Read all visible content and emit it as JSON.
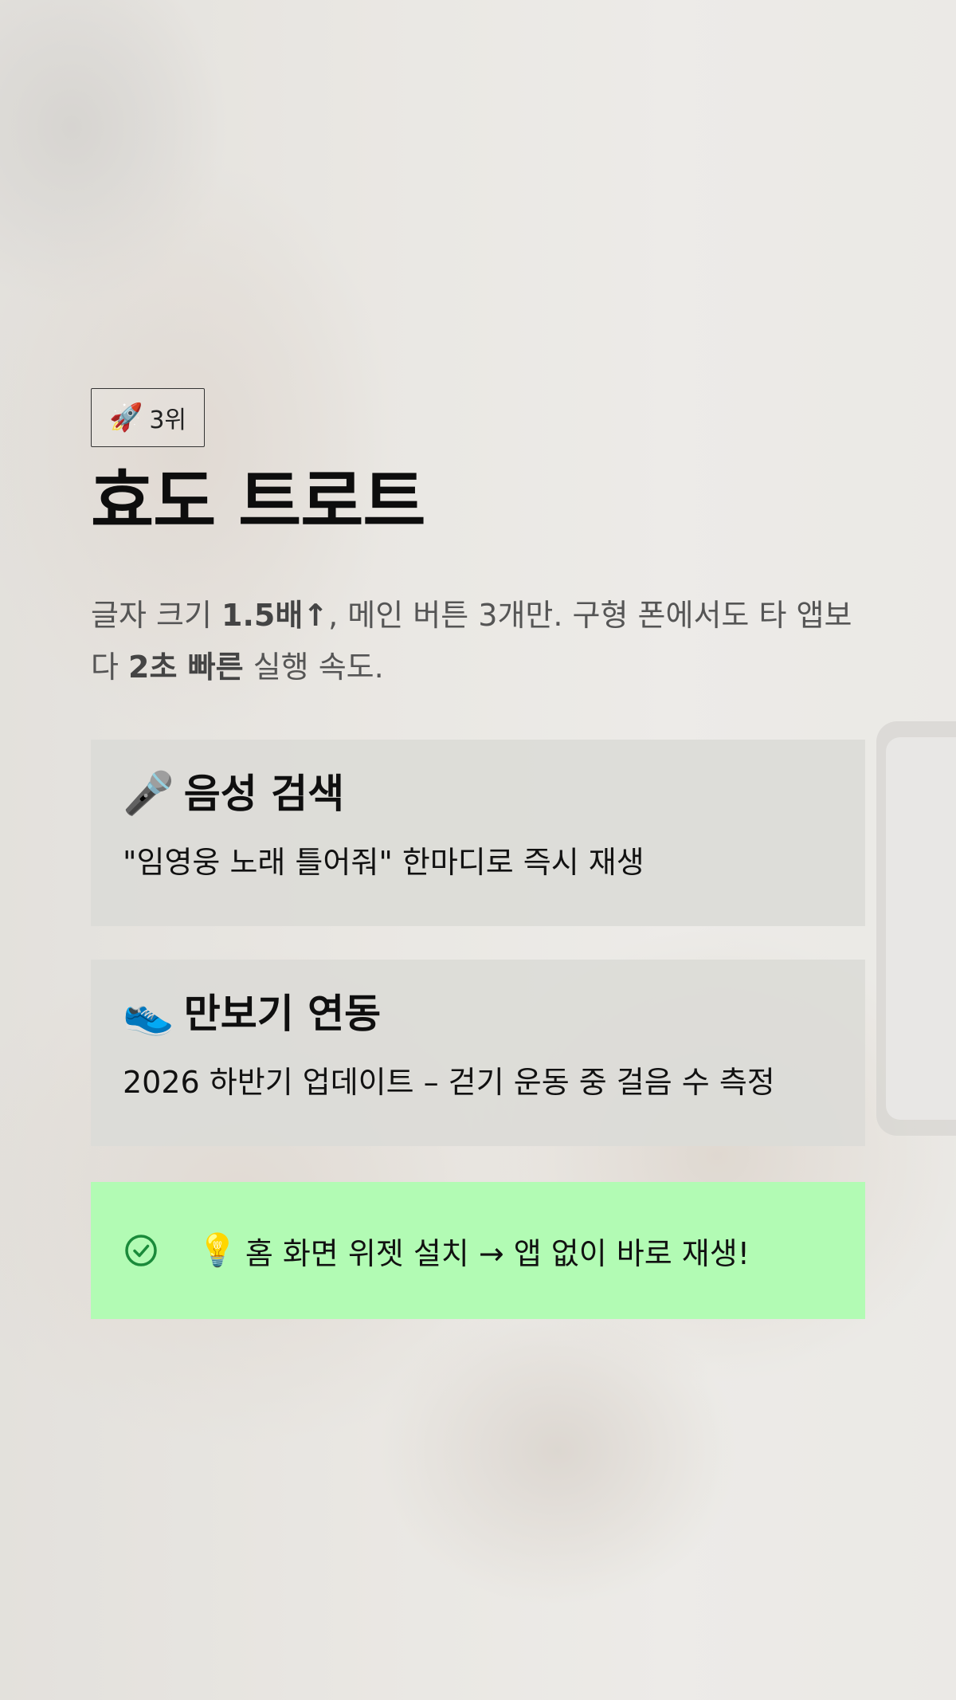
{
  "badge": {
    "icon": "rocket-icon",
    "icon_glyph": "🚀",
    "label": "3위"
  },
  "title": "효도 트로트",
  "description": {
    "part1": "글자 크기 ",
    "bold1": "1.5배↑",
    "part2": ", 메인 버튼 3개만. 구형 폰에서도 타 앱보다 ",
    "bold2": "2초 빠른",
    "part3": " 실행 속도."
  },
  "features": [
    {
      "icon": "microphone-icon",
      "icon_glyph": "🎤",
      "title": "음성 검색",
      "desc": "\"임영웅 노래 틀어줘\" 한마디로 즉시 재생"
    },
    {
      "icon": "sneaker-icon",
      "icon_glyph": "👟",
      "title": "만보기 연동",
      "desc": "2026 하반기 업데이트 – 걷기 운동 중 걸음 수 측정"
    }
  ],
  "tip": {
    "check_icon": "check-circle-icon",
    "icon": "lightbulb-icon",
    "icon_glyph": "💡",
    "text": "홈 화면 위젯 설치 → 앱 없이 바로 재생!"
  },
  "colors": {
    "tip_background": "#b2fbb4",
    "check_green": "#1a8a3a",
    "card_background": "#dbdbd7"
  }
}
